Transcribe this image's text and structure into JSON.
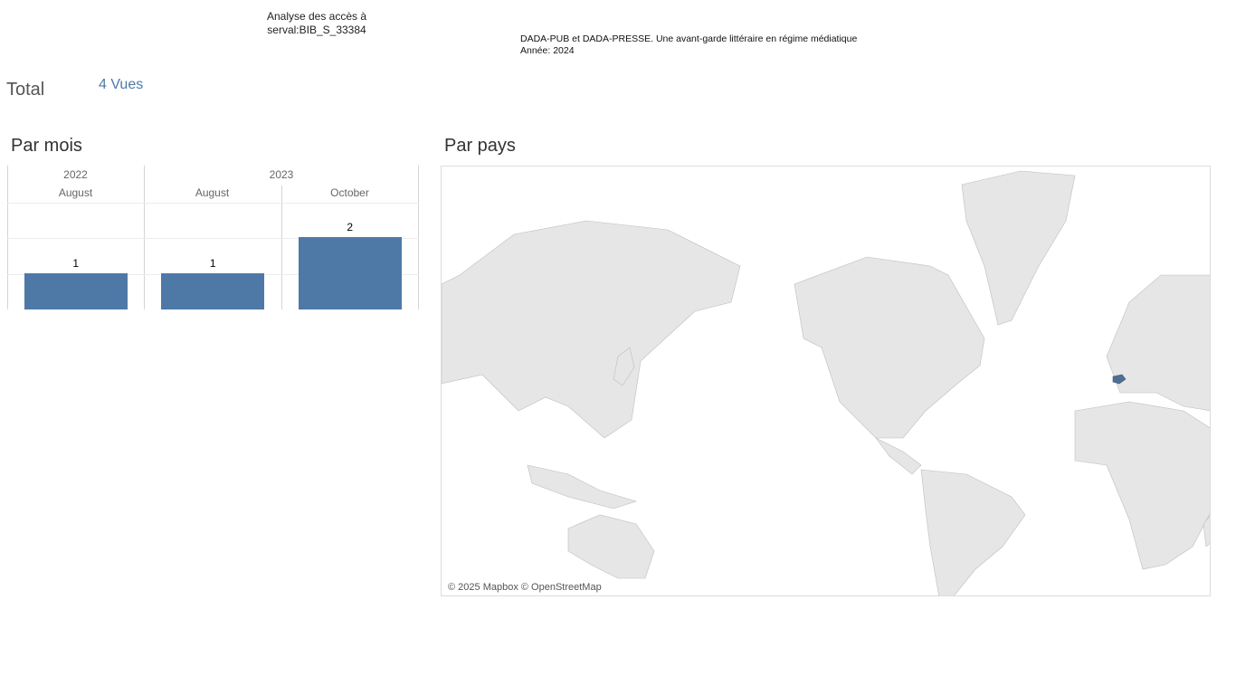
{
  "header": {
    "title_line1": "Analyse des accès à",
    "title_line2": "serval:BIB_S_33384"
  },
  "document": {
    "title": "DADA-PUB et DADA-PRESSE. Une avant-garde littéraire en régime médiatique",
    "year": "Année: 2024"
  },
  "total": {
    "label": "Total",
    "value": "4 Vues"
  },
  "sections": {
    "by_month": "Par mois",
    "by_country": "Par pays"
  },
  "chart_data": {
    "type": "bar",
    "title": "Par mois",
    "years": [
      "2022",
      "2023"
    ],
    "categories": [
      "August",
      "August",
      "October"
    ],
    "category_years": [
      "2022",
      "2023",
      "2023"
    ],
    "values": [
      1,
      1,
      2
    ],
    "data_labels": [
      "1",
      "1",
      "2"
    ],
    "ylim": [
      0,
      2
    ],
    "grid": true,
    "colors": {
      "bar": "#4e79a7"
    }
  },
  "map": {
    "credit": "© 2025 Mapbox © OpenStreetMap",
    "highlighted_country": "Switzerland",
    "colors": {
      "land": "#e6e6e6",
      "borders": "#9a9a9a",
      "highlight": "#4e6f8f",
      "water": "#ffffff"
    }
  }
}
